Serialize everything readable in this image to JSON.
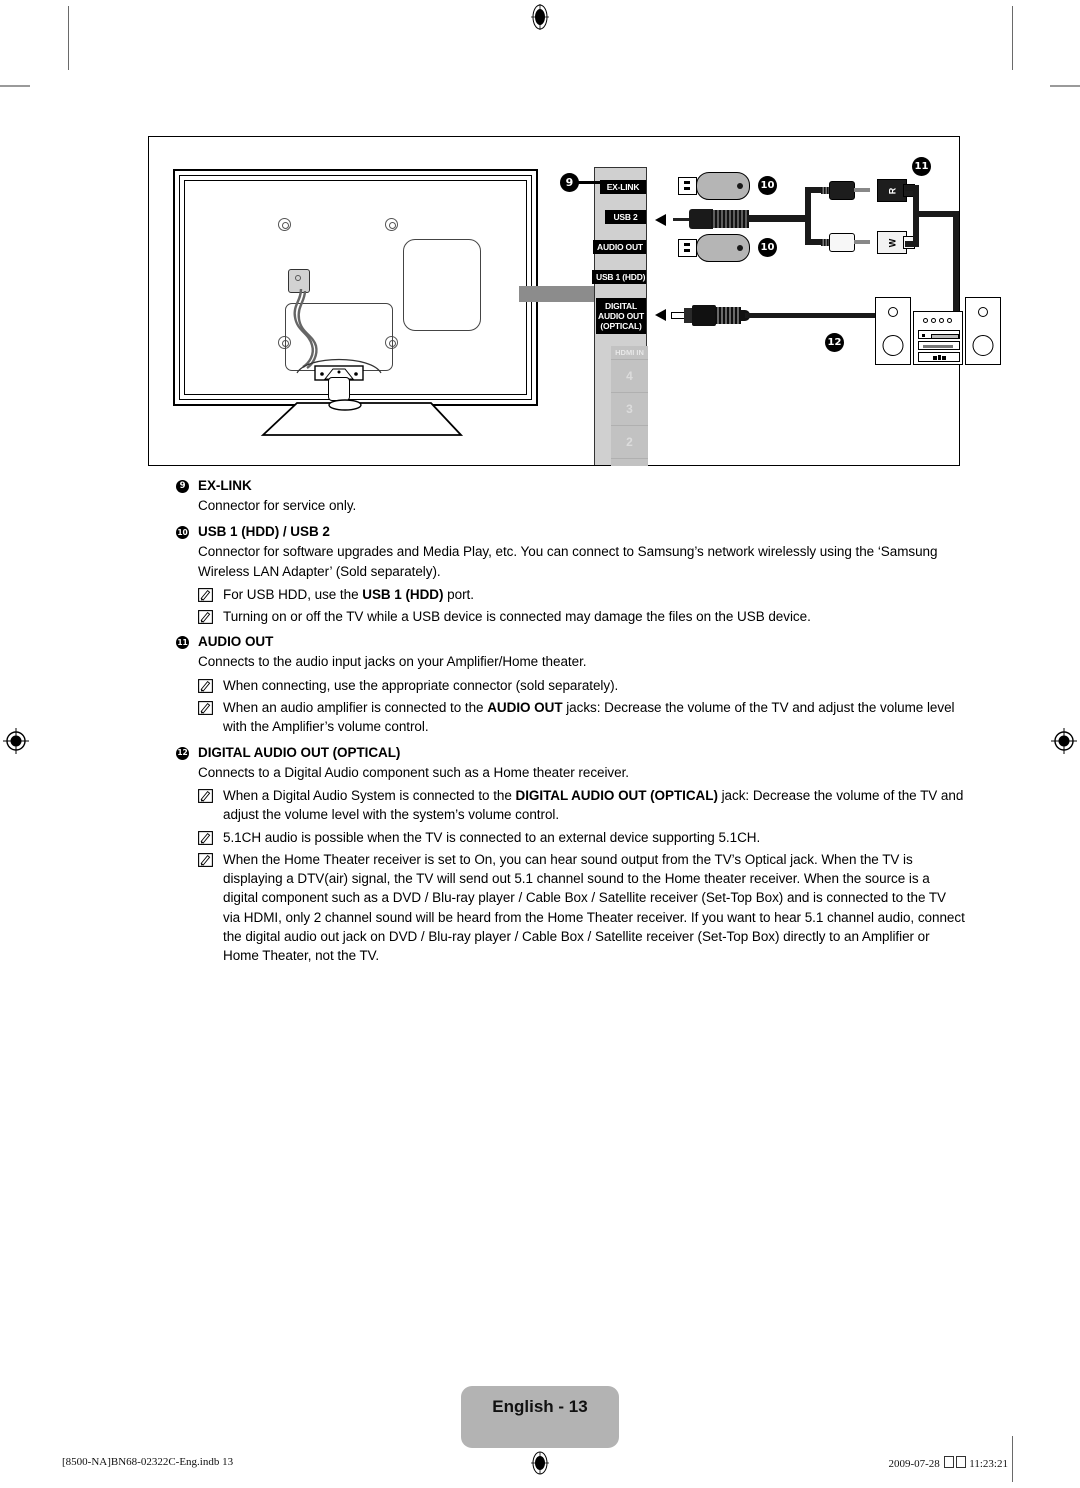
{
  "document": {
    "type": "samsung-tv-user-manual-page",
    "page_label": "English - 13"
  },
  "diagram": {
    "name": "tv-rear-connection-diagram",
    "connector_panel": {
      "ports": [
        {
          "id": "ex-link",
          "label": "EX-LINK"
        },
        {
          "id": "usb-2",
          "label": "USB 2"
        },
        {
          "id": "audio-out",
          "label": "AUDIO OUT"
        },
        {
          "id": "usb-1-hdd",
          "label": "USB 1 (HDD)"
        },
        {
          "id": "digital-audio-out-optical",
          "label": "DIGITAL\nAUDIO OUT\n(OPTICAL)"
        }
      ],
      "hdmi": {
        "header": "HDMI IN",
        "numbers": [
          "4",
          "3",
          "2"
        ]
      }
    },
    "callouts": [
      {
        "id": "callout-9",
        "number": "9",
        "target": "EX-LINK"
      },
      {
        "id": "callout-10a",
        "number": "10",
        "target": "USB 2"
      },
      {
        "id": "callout-10b",
        "number": "10",
        "target": "USB 1 (HDD)"
      },
      {
        "id": "callout-11",
        "number": "11",
        "target": "AUDIO OUT"
      },
      {
        "id": "callout-12",
        "number": "12",
        "target": "DIGITAL AUDIO OUT (OPTICAL)"
      }
    ],
    "rca_connectors": [
      {
        "id": "rca-right",
        "label": "R",
        "color": "#1d1d1d"
      },
      {
        "id": "rca-white",
        "label": "W",
        "color": "#f2f2f2"
      }
    ]
  },
  "sections": [
    {
      "id": "ex-link",
      "number": "9",
      "title": "EX-LINK",
      "description": "Connector for service only.",
      "notes": []
    },
    {
      "id": "usb",
      "number": "10",
      "title": "USB 1 (HDD) / USB 2",
      "description": "Connector for software upgrades and Media Play, etc. You can connect to Samsung’s network wirelessly using the ‘Samsung Wireless LAN Adapter’ (Sold separately).",
      "notes": [
        {
          "parts": [
            {
              "t": "For USB HDD, use the ",
              "b": false
            },
            {
              "t": "USB 1 (HDD)",
              "b": true
            },
            {
              "t": " port.",
              "b": false
            }
          ]
        },
        {
          "parts": [
            {
              "t": "Turning on or off the TV while a USB device is connected may damage the files on the USB device.",
              "b": false
            }
          ]
        }
      ]
    },
    {
      "id": "audio-out",
      "number": "11",
      "title": "AUDIO OUT",
      "description": "Connects to the audio input jacks on your Amplifier/Home theater.",
      "notes": [
        {
          "parts": [
            {
              "t": "When connecting, use the appropriate connector (sold separately).",
              "b": false
            }
          ]
        },
        {
          "parts": [
            {
              "t": "When an audio amplifier is connected to the ",
              "b": false
            },
            {
              "t": "AUDIO OUT",
              "b": true
            },
            {
              "t": " jacks: Decrease the volume of the TV and adjust the volume level with the Amplifier’s volume control.",
              "b": false
            }
          ]
        }
      ]
    },
    {
      "id": "digital-audio-out-optical",
      "number": "12",
      "title": "DIGITAL AUDIO OUT (OPTICAL)",
      "description": "Connects to a Digital Audio component such as a Home theater receiver.",
      "notes": [
        {
          "parts": [
            {
              "t": "When a Digital Audio System is connected to the ",
              "b": false
            },
            {
              "t": "DIGITAL AUDIO OUT (OPTICAL)",
              "b": true
            },
            {
              "t": " jack: Decrease the volume of the TV and adjust the volume level with the system’s volume control.",
              "b": false
            }
          ]
        },
        {
          "parts": [
            {
              "t": "5.1CH audio is possible when the TV is connected to an external device supporting 5.1CH.",
              "b": false
            }
          ]
        },
        {
          "parts": [
            {
              "t": "When the Home Theater receiver is set to On, you can hear sound output from the TV’s Optical jack. When the TV is displaying a DTV(air) signal, the TV will send out 5.1 channel sound to the Home theater receiver. When the source is a digital component such as a DVD / Blu-ray player / Cable Box / Satellite receiver (Set-Top Box) and is connected to the TV via HDMI, only 2 channel sound will be heard from the Home Theater receiver. If you want to hear 5.1 channel audio, connect the digital audio out jack on DVD / Blu-ray player / Cable Box / Satellite receiver (Set-Top Box) directly to an Amplifier or Home Theater, not the TV.",
              "b": false
            }
          ]
        }
      ]
    }
  ],
  "footer": {
    "page_badge": "English - 13",
    "file_ref": "[8500-NA]BN68-02322C-Eng.indb   13",
    "timestamp_date": "2009-07-28",
    "timestamp_time": "11:23:21"
  },
  "colors": {
    "panel_gray": "#d0d0d0",
    "badge_gray": "#b3b3b3",
    "port_label_bg": "#000000",
    "hdmi_gray": "#c2c2c2"
  }
}
